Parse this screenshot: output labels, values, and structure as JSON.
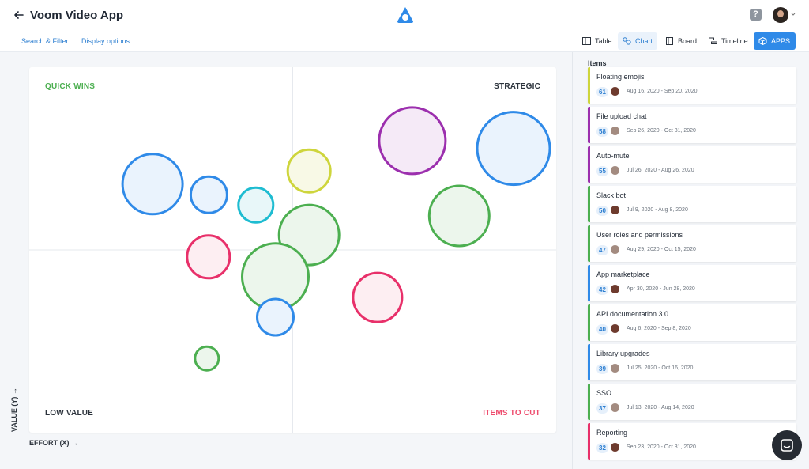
{
  "header": {
    "title": "Voom Video App",
    "help_glyph": "?"
  },
  "subbar": {
    "search_filter": "Search & Filter",
    "display_options": "Display options",
    "views": [
      {
        "label": "Table",
        "icon": "table-icon"
      },
      {
        "label": "Chart",
        "icon": "chart-icon",
        "active": true
      },
      {
        "label": "Board",
        "icon": "board-icon"
      },
      {
        "label": "Timeline",
        "icon": "timeline-icon"
      },
      {
        "label": "APPS",
        "icon": "cube-icon"
      }
    ]
  },
  "chart": {
    "quadrants": {
      "top_left": "QUICK WINS",
      "top_right": "STRATEGIC",
      "bottom_left": "LOW VALUE",
      "bottom_right": "ITEMS TO CUT"
    },
    "x_axis_label": "EFFORT (X) →",
    "y_axis_label": "VALUE (Y) →",
    "colors": {
      "quick_wins": "#4caf50",
      "strategic": "#2c333c",
      "low_value": "#2c333c",
      "items_to_cut": "#ee4d6e"
    }
  },
  "chart_data": {
    "type": "scatter",
    "title": "",
    "xlabel": "EFFORT (X) →",
    "ylabel": "VALUE (Y) →",
    "points": [
      {
        "cx": 23.4,
        "cy": 68.0,
        "size": 38,
        "color": "#2f8ae8",
        "fill": "#eaf3fd"
      },
      {
        "cx": 34.1,
        "cy": 65.1,
        "size": 23,
        "color": "#2f8ae8",
        "fill": "#eaf3fd"
      },
      {
        "cx": 43.0,
        "cy": 62.3,
        "size": 22,
        "color": "#1ebcd1",
        "fill": "#e8f7f9"
      },
      {
        "cx": 53.1,
        "cy": 71.6,
        "size": 27,
        "color": "#ced53c",
        "fill": "#f8f9e6"
      },
      {
        "cx": 53.1,
        "cy": 54.1,
        "size": 38,
        "color": "#4caf50",
        "fill": "#ecf6ec"
      },
      {
        "cx": 34.0,
        "cy": 48.1,
        "size": 27,
        "color": "#e8306a",
        "fill": "#fdeef2"
      },
      {
        "cx": 46.7,
        "cy": 42.7,
        "size": 42,
        "color": "#4caf50",
        "fill": "#ecf6ec"
      },
      {
        "cx": 46.7,
        "cy": 31.6,
        "size": 23,
        "color": "#2f8ae8",
        "fill": "#eaf3fd"
      },
      {
        "cx": 33.7,
        "cy": 20.3,
        "size": 15,
        "color": "#4caf50",
        "fill": "#ecf6ec"
      },
      {
        "cx": 72.7,
        "cy": 79.9,
        "size": 42,
        "color": "#9c2fae",
        "fill": "#f5eaf7"
      },
      {
        "cx": 91.9,
        "cy": 77.8,
        "size": 46,
        "color": "#2f8ae8",
        "fill": "#eaf3fd"
      },
      {
        "cx": 81.6,
        "cy": 59.3,
        "size": 38,
        "color": "#4caf50",
        "fill": "#ecf6ec"
      },
      {
        "cx": 66.1,
        "cy": 37.0,
        "size": 31,
        "color": "#e8306a",
        "fill": "#fdeef2"
      }
    ]
  },
  "items_panel": {
    "heading": "Items",
    "items": [
      {
        "title": "Floating emojis",
        "score": "61",
        "dates": "Aug 16, 2020 - Sep 20, 2020",
        "color": "#ced53c",
        "avatar": "dark"
      },
      {
        "title": "File upload chat",
        "score": "58",
        "dates": "Sep 26, 2020 - Oct 31, 2020",
        "color": "#9c2fae",
        "avatar": "lite"
      },
      {
        "title": "Auto-mute",
        "score": "55",
        "dates": "Jul 26, 2020 - Aug 26, 2020",
        "color": "#9c2fae",
        "avatar": "lite"
      },
      {
        "title": "Slack bot",
        "score": "50",
        "dates": "Jul 9, 2020 - Aug 8, 2020",
        "color": "#4caf50",
        "avatar": "dark"
      },
      {
        "title": "User roles and permissions",
        "score": "47",
        "dates": "Aug 29, 2020 - Oct 15, 2020",
        "color": "#4caf50",
        "avatar": "lite"
      },
      {
        "title": "App marketplace",
        "score": "42",
        "dates": "Apr 30, 2020 - Jun 28, 2020",
        "color": "#2f8ae8",
        "avatar": "dark"
      },
      {
        "title": "API documentation 3.0",
        "score": "40",
        "dates": "Aug 6, 2020 - Sep 8, 2020",
        "color": "#4caf50",
        "avatar": "dark"
      },
      {
        "title": "Library upgrades",
        "score": "39",
        "dates": "Jul 25, 2020 - Oct 16, 2020",
        "color": "#2f8ae8",
        "avatar": "lite"
      },
      {
        "title": "SSO",
        "score": "37",
        "dates": "Jul 13, 2020 - Aug 14, 2020",
        "color": "#4caf50",
        "avatar": "lite"
      },
      {
        "title": "Reporting",
        "score": "32",
        "dates": "Sep 23, 2020 - Oct 31, 2020",
        "color": "#e8306a",
        "avatar": "dark"
      }
    ]
  }
}
